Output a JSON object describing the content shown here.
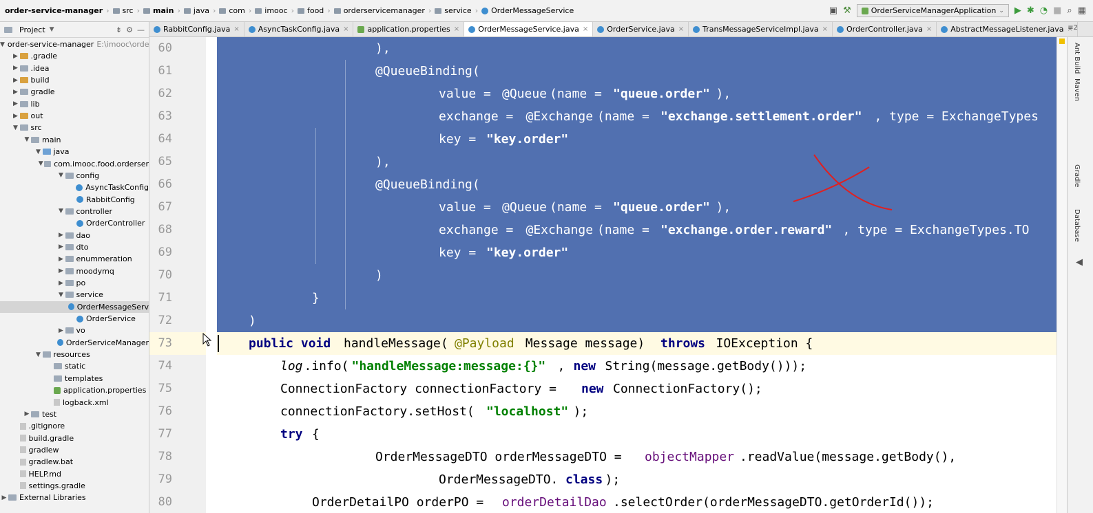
{
  "breadcrumbs": [
    "order-service-manager",
    "src",
    "main",
    "java",
    "com",
    "imooc",
    "food",
    "orderservicemanager",
    "service",
    "OrderMessageService"
  ],
  "run_config": "OrderServiceManagerApplication",
  "project_panel": {
    "title": "Project",
    "root_name": "order-service-manager",
    "root_path": "E:\\imooc\\orde",
    "items": [
      {
        "label": ".gradle",
        "depth": 1,
        "arrow": "▶",
        "icon": "folder-orange"
      },
      {
        "label": ".idea",
        "depth": 1,
        "arrow": "▶",
        "icon": "folder"
      },
      {
        "label": "build",
        "depth": 1,
        "arrow": "▶",
        "icon": "folder-orange"
      },
      {
        "label": "gradle",
        "depth": 1,
        "arrow": "▶",
        "icon": "folder"
      },
      {
        "label": "lib",
        "depth": 1,
        "arrow": "▶",
        "icon": "folder"
      },
      {
        "label": "out",
        "depth": 1,
        "arrow": "▶",
        "icon": "folder-orange"
      },
      {
        "label": "src",
        "depth": 1,
        "arrow": "▼",
        "icon": "folder"
      },
      {
        "label": "main",
        "depth": 2,
        "arrow": "▼",
        "icon": "folder"
      },
      {
        "label": "java",
        "depth": 3,
        "arrow": "▼",
        "icon": "folder-blue"
      },
      {
        "label": "com.imooc.food.orderser",
        "depth": 4,
        "arrow": "▼",
        "icon": "folder"
      },
      {
        "label": "config",
        "depth": 5,
        "arrow": "▼",
        "icon": "folder"
      },
      {
        "label": "AsyncTaskConfig",
        "depth": 6,
        "arrow": "",
        "icon": "class"
      },
      {
        "label": "RabbitConfig",
        "depth": 6,
        "arrow": "",
        "icon": "class"
      },
      {
        "label": "controller",
        "depth": 5,
        "arrow": "▼",
        "icon": "folder"
      },
      {
        "label": "OrderController",
        "depth": 6,
        "arrow": "",
        "icon": "class"
      },
      {
        "label": "dao",
        "depth": 5,
        "arrow": "▶",
        "icon": "folder"
      },
      {
        "label": "dto",
        "depth": 5,
        "arrow": "▶",
        "icon": "folder"
      },
      {
        "label": "enummeration",
        "depth": 5,
        "arrow": "▶",
        "icon": "folder"
      },
      {
        "label": "moodymq",
        "depth": 5,
        "arrow": "▶",
        "icon": "folder"
      },
      {
        "label": "po",
        "depth": 5,
        "arrow": "▶",
        "icon": "folder"
      },
      {
        "label": "service",
        "depth": 5,
        "arrow": "▼",
        "icon": "folder"
      },
      {
        "label": "OrderMessageServ",
        "depth": 6,
        "arrow": "",
        "icon": "class",
        "selected": true
      },
      {
        "label": "OrderService",
        "depth": 6,
        "arrow": "",
        "icon": "class"
      },
      {
        "label": "vo",
        "depth": 5,
        "arrow": "▶",
        "icon": "folder"
      },
      {
        "label": "OrderServiceManager",
        "depth": 5,
        "arrow": "",
        "icon": "class"
      },
      {
        "label": "resources",
        "depth": 3,
        "arrow": "▼",
        "icon": "folder"
      },
      {
        "label": "static",
        "depth": 4,
        "arrow": "",
        "icon": "folder"
      },
      {
        "label": "templates",
        "depth": 4,
        "arrow": "",
        "icon": "folder"
      },
      {
        "label": "application.properties",
        "depth": 4,
        "arrow": "",
        "icon": "leaf"
      },
      {
        "label": "logback.xml",
        "depth": 4,
        "arrow": "",
        "icon": "file"
      },
      {
        "label": "test",
        "depth": 2,
        "arrow": "▶",
        "icon": "folder"
      },
      {
        "label": ".gitignore",
        "depth": 1,
        "arrow": "",
        "icon": "file"
      },
      {
        "label": "build.gradle",
        "depth": 1,
        "arrow": "",
        "icon": "file"
      },
      {
        "label": "gradlew",
        "depth": 1,
        "arrow": "",
        "icon": "file"
      },
      {
        "label": "gradlew.bat",
        "depth": 1,
        "arrow": "",
        "icon": "file"
      },
      {
        "label": "HELP.md",
        "depth": 1,
        "arrow": "",
        "icon": "file"
      },
      {
        "label": "settings.gradle",
        "depth": 1,
        "arrow": "",
        "icon": "file"
      },
      {
        "label": "External Libraries",
        "depth": 0,
        "arrow": "▶",
        "icon": "folder"
      }
    ]
  },
  "tabs": [
    {
      "label": "RabbitConfig.java",
      "icon": "class"
    },
    {
      "label": "AsyncTaskConfig.java",
      "icon": "class"
    },
    {
      "label": "application.properties",
      "icon": "leaf"
    },
    {
      "label": "OrderMessageService.java",
      "icon": "class",
      "active": true
    },
    {
      "label": "OrderService.java",
      "icon": "class"
    },
    {
      "label": "TransMessageServiceImpl.java",
      "icon": "class"
    },
    {
      "label": "OrderController.java",
      "icon": "class"
    },
    {
      "label": "AbstractMessageListener.java",
      "icon": "class"
    }
  ],
  "tab_counter": "≡2",
  "right_tools": [
    "Ant Build",
    "Maven",
    "Gradle",
    "Database"
  ],
  "code_lines": [
    {
      "n": "60",
      "selected": true,
      "indent": 20,
      "tokens": [
        {
          "t": "),",
          "c": "plain"
        }
      ]
    },
    {
      "n": "61",
      "selected": true,
      "indent": 20,
      "tokens": [
        {
          "t": "@QueueBinding(",
          "c": "ann"
        }
      ]
    },
    {
      "n": "62",
      "selected": true,
      "indent": 28,
      "tokens": [
        {
          "t": "value = ",
          "c": "plain"
        },
        {
          "t": "@Queue",
          "c": "ann"
        },
        {
          "t": "(name = ",
          "c": "plain"
        },
        {
          "t": "\"queue.order\"",
          "c": "str"
        },
        {
          "t": "),",
          "c": "plain"
        }
      ]
    },
    {
      "n": "63",
      "selected": true,
      "indent": 28,
      "tokens": [
        {
          "t": "exchange = ",
          "c": "plain"
        },
        {
          "t": "@Exchange",
          "c": "ann"
        },
        {
          "t": "(name = ",
          "c": "plain"
        },
        {
          "t": "\"exchange.settlement.order\"",
          "c": "str"
        },
        {
          "t": ", type = ExchangeTypes",
          "c": "plain"
        }
      ]
    },
    {
      "n": "64",
      "selected": true,
      "indent": 28,
      "tokens": [
        {
          "t": "key = ",
          "c": "plain"
        },
        {
          "t": "\"key.order\"",
          "c": "str"
        }
      ]
    },
    {
      "n": "65",
      "selected": true,
      "indent": 20,
      "tokens": [
        {
          "t": "),",
          "c": "plain"
        }
      ]
    },
    {
      "n": "66",
      "selected": true,
      "indent": 20,
      "tokens": [
        {
          "t": "@QueueBinding(",
          "c": "ann"
        }
      ]
    },
    {
      "n": "67",
      "selected": true,
      "indent": 28,
      "tokens": [
        {
          "t": "value = ",
          "c": "plain"
        },
        {
          "t": "@Queue",
          "c": "ann"
        },
        {
          "t": "(name = ",
          "c": "plain"
        },
        {
          "t": "\"queue.order\"",
          "c": "str"
        },
        {
          "t": "),",
          "c": "plain"
        }
      ]
    },
    {
      "n": "68",
      "selected": true,
      "indent": 28,
      "tokens": [
        {
          "t": "exchange = ",
          "c": "plain"
        },
        {
          "t": "@Exchange",
          "c": "ann"
        },
        {
          "t": "(name = ",
          "c": "plain"
        },
        {
          "t": "\"exchange.order.reward\"",
          "c": "str"
        },
        {
          "t": ", type = ExchangeTypes.TO",
          "c": "plain"
        }
      ]
    },
    {
      "n": "69",
      "selected": true,
      "indent": 28,
      "tokens": [
        {
          "t": "key = ",
          "c": "plain"
        },
        {
          "t": "\"key.order\"",
          "c": "str"
        }
      ]
    },
    {
      "n": "70",
      "selected": true,
      "indent": 20,
      "tokens": [
        {
          "t": ")",
          "c": "plain"
        }
      ]
    },
    {
      "n": "71",
      "selected": true,
      "indent": 12,
      "tokens": [
        {
          "t": "}",
          "c": "plain"
        }
      ]
    },
    {
      "n": "72",
      "selected": true,
      "indent": 4,
      "tokens": [
        {
          "t": ")",
          "c": "plain"
        }
      ]
    },
    {
      "n": "73",
      "selected": false,
      "current": true,
      "indent": 4,
      "tokens": [
        {
          "t": "public void ",
          "c": "kw"
        },
        {
          "t": "handleMessage(",
          "c": "plain"
        },
        {
          "t": "@Payload",
          "c": "ann"
        },
        {
          "t": " Message message) ",
          "c": "plain"
        },
        {
          "t": "throws ",
          "c": "kw"
        },
        {
          "t": "IOException {",
          "c": "plain"
        }
      ]
    },
    {
      "n": "74",
      "selected": false,
      "indent": 8,
      "tokens": [
        {
          "t": "log",
          "c": "static-it"
        },
        {
          "t": ".info(",
          "c": "plain"
        },
        {
          "t": "\"handleMessage:message:{}\"",
          "c": "str"
        },
        {
          "t": ", ",
          "c": "plain"
        },
        {
          "t": "new ",
          "c": "kw"
        },
        {
          "t": "String(message.getBody()));",
          "c": "plain"
        }
      ]
    },
    {
      "n": "75",
      "selected": false,
      "indent": 8,
      "tokens": [
        {
          "t": "ConnectionFactory connectionFactory = ",
          "c": "plain"
        },
        {
          "t": "new ",
          "c": "kw"
        },
        {
          "t": "ConnectionFactory();",
          "c": "plain"
        }
      ]
    },
    {
      "n": "76",
      "selected": false,
      "indent": 8,
      "tokens": [
        {
          "t": "connectionFactory.setHost(",
          "c": "plain"
        },
        {
          "t": "\"localhost\"",
          "c": "str"
        },
        {
          "t": ");",
          "c": "plain"
        }
      ]
    },
    {
      "n": "77",
      "selected": false,
      "indent": 8,
      "tokens": [
        {
          "t": "try ",
          "c": "kw"
        },
        {
          "t": "{",
          "c": "plain"
        }
      ]
    },
    {
      "n": "78",
      "selected": false,
      "indent": 20,
      "tokens": [
        {
          "t": "OrderMessageDTO orderMessageDTO = ",
          "c": "plain"
        },
        {
          "t": "objectMapper",
          "c": "field"
        },
        {
          "t": ".readValue(message.getBody(),",
          "c": "plain"
        }
      ]
    },
    {
      "n": "79",
      "selected": false,
      "indent": 28,
      "tokens": [
        {
          "t": "OrderMessageDTO.",
          "c": "plain"
        },
        {
          "t": "class",
          "c": "kw"
        },
        {
          "t": ");",
          "c": "plain"
        }
      ]
    },
    {
      "n": "80",
      "selected": false,
      "indent": 12,
      "tokens": [
        {
          "t": "OrderDetailPO orderPO = ",
          "c": "plain"
        },
        {
          "t": "orderDetailDao",
          "c": "field"
        },
        {
          "t": ".selectOrder(orderMessageDTO.getOrderId());",
          "c": "plain"
        }
      ]
    }
  ]
}
